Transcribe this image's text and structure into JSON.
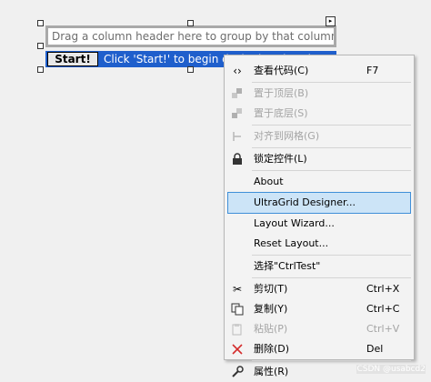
{
  "designer": {
    "group_by_text": "Drag a column header here to group by that column.",
    "start_button": "Start!",
    "start_hint": "Click 'Start!' to begin designing the UltraGrid"
  },
  "context_menu": {
    "items": [
      {
        "label": "查看代码(C)",
        "shortcut": "F7",
        "icon": "code-icon",
        "disabled": false
      },
      {
        "label": "置于顶层(B)",
        "shortcut": "",
        "icon": "bring-to-front-icon",
        "disabled": true
      },
      {
        "label": "置于底层(S)",
        "shortcut": "",
        "icon": "send-to-back-icon",
        "disabled": true
      },
      {
        "label": "对齐到网格(G)",
        "shortcut": "",
        "icon": "align-grid-icon",
        "disabled": true
      },
      {
        "label": "锁定控件(L)",
        "shortcut": "",
        "icon": "lock-icon",
        "disabled": false
      },
      {
        "label": "About",
        "shortcut": "",
        "icon": "",
        "disabled": false
      },
      {
        "label": "UltraGrid Designer...",
        "shortcut": "",
        "icon": "",
        "disabled": false
      },
      {
        "label": "Layout Wizard...",
        "shortcut": "",
        "icon": "",
        "disabled": false
      },
      {
        "label": "Reset Layout...",
        "shortcut": "",
        "icon": "",
        "disabled": false
      },
      {
        "label": "选择\"CtrlTest\"",
        "shortcut": "",
        "icon": "",
        "disabled": false
      },
      {
        "label": "剪切(T)",
        "shortcut": "Ctrl+X",
        "icon": "scissors-icon",
        "disabled": false
      },
      {
        "label": "复制(Y)",
        "shortcut": "Ctrl+C",
        "icon": "copy-icon",
        "disabled": false
      },
      {
        "label": "粘贴(P)",
        "shortcut": "Ctrl+V",
        "icon": "paste-icon",
        "disabled": true
      },
      {
        "label": "删除(D)",
        "shortcut": "Del",
        "icon": "delete-icon",
        "disabled": false
      },
      {
        "label": "属性(R)",
        "shortcut": "",
        "icon": "wrench-icon",
        "disabled": false
      }
    ]
  },
  "watermark": "CSDN @usabcd2",
  "colors": {
    "start_bar": "#1f5fcc",
    "menu_highlight": "#cce4f7",
    "menu_highlight_border": "#3f8fd8",
    "delete_icon": "#d42b2b"
  }
}
